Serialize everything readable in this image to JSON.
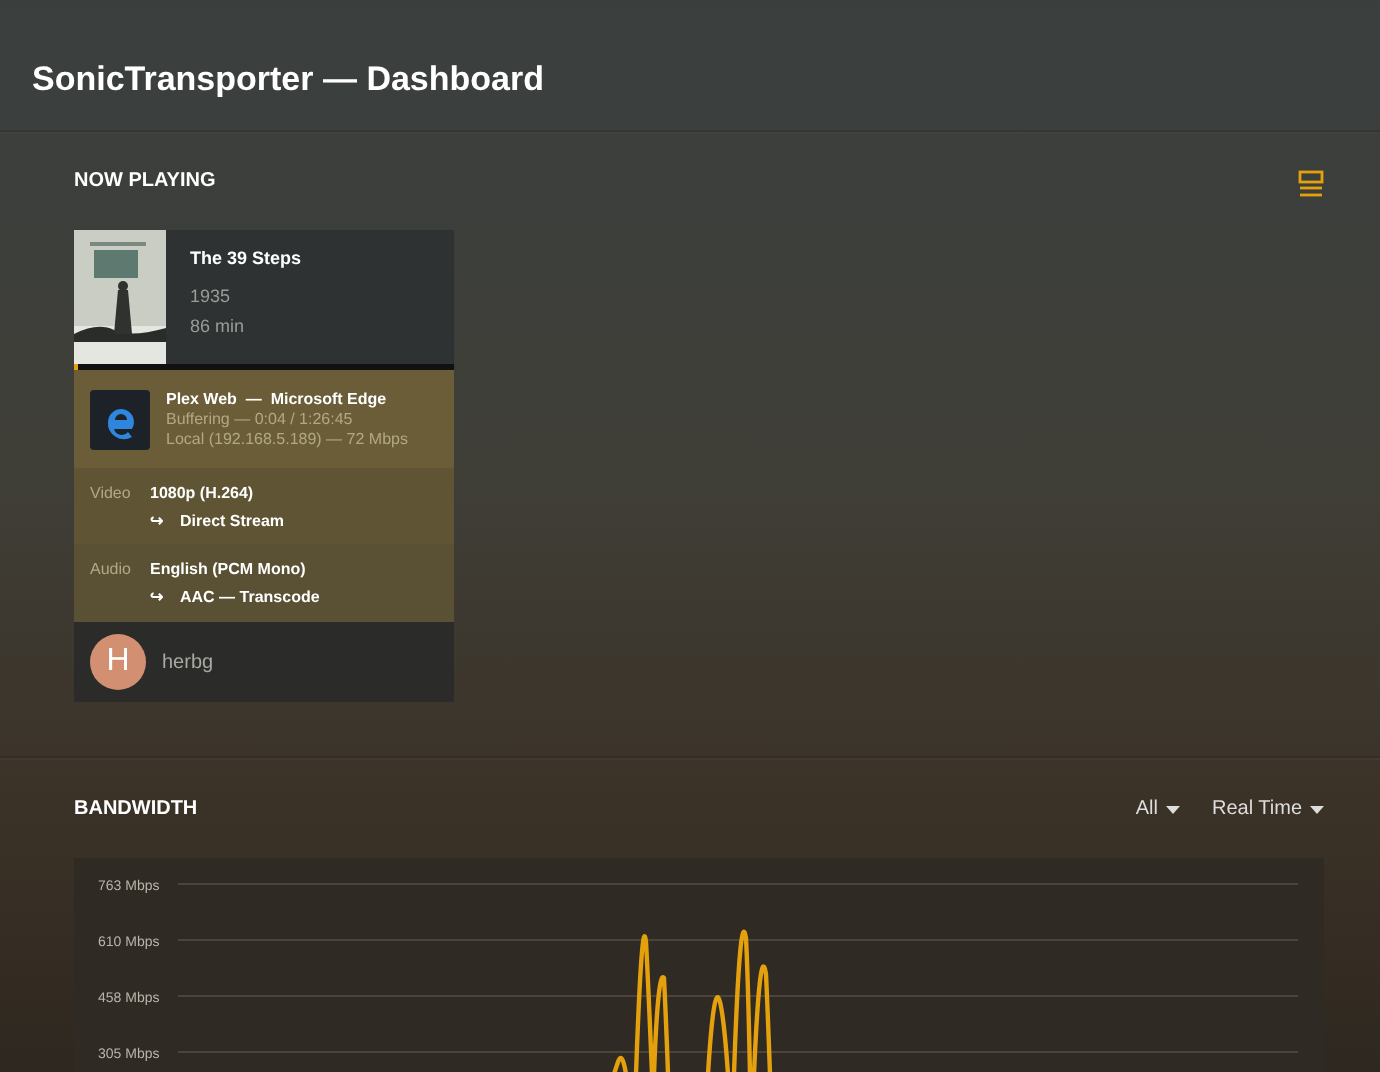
{
  "page": {
    "title": "SonicTransporter — Dashboard"
  },
  "now_playing": {
    "heading": "NOW PLAYING",
    "sessions": [
      {
        "media": {
          "title": "The 39 Steps",
          "year": "1935",
          "duration": "86 min"
        },
        "progress": {
          "level": 0.01
        },
        "player": {
          "name": "Plex Web",
          "separator": "—",
          "browser": "Microsoft Edge",
          "state": "Buffering — 0:04 / 1:26:45",
          "network": "Local (192.168.5.189) — 72 Mbps"
        },
        "streams": [
          {
            "label": "Video",
            "value": "1080p (H.264)",
            "arrow": "↪",
            "decision": "Direct Stream"
          },
          {
            "label": "Audio",
            "value": "English (PCM Mono)",
            "arrow": "↪",
            "decision": "AAC — Transcode"
          }
        ],
        "user": {
          "initial": "H",
          "name": "herbg"
        }
      }
    ]
  },
  "bandwidth": {
    "heading": "BANDWIDTH",
    "filters": [
      {
        "label": "All"
      },
      {
        "label": "Real Time"
      }
    ],
    "y_axis_labels": [
      "763 Mbps",
      "610 Mbps",
      "458 Mbps",
      "305 Mbps"
    ]
  }
}
